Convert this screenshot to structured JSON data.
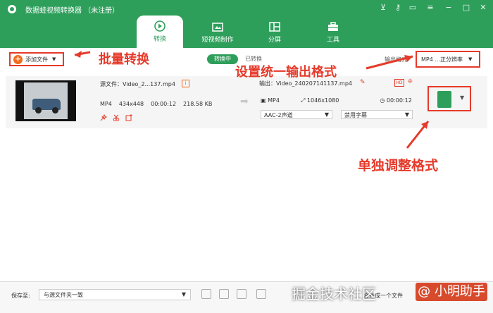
{
  "app": {
    "title": "数据蛙视频转换器 （未注册）"
  },
  "titlebar": {
    "icons": [
      "cart-icon",
      "key-icon",
      "feedback-icon",
      "menu-icon",
      "minimize-icon",
      "maximize-icon",
      "close-icon"
    ]
  },
  "tabs": [
    {
      "label": "转换",
      "icon": "convert-icon",
      "active": true
    },
    {
      "label": "短视频制作",
      "icon": "short-video-icon",
      "active": false
    },
    {
      "label": "分屏",
      "icon": "split-screen-icon",
      "active": false
    },
    {
      "label": "工具",
      "icon": "toolbox-icon",
      "active": false
    }
  ],
  "toolbar": {
    "add_label": "添加文件",
    "seg_converting": "转换中",
    "seg_converted": "已转换",
    "output_format_label": "输出格式:",
    "output_format_value": "MP4 ...正分辨率"
  },
  "file": {
    "source_label": "源文件：Video_2...137.mp4",
    "format": "MP4",
    "resolution": "434x448",
    "duration": "00:00:12",
    "size": "218.58 KB",
    "output_label": "输出：Video_240207141137.mp4",
    "out_format": "MP4",
    "out_resolution": "1046x1080",
    "out_duration": "00:00:12",
    "audio": "AAC-2声道",
    "subtitle": "禁用字幕"
  },
  "bottom": {
    "save_label": "保存至:",
    "save_path": "与源文件夹一致",
    "merge_label": "合并成一个文件"
  },
  "annotations": {
    "batch": "批量转换",
    "unified": "设置统一输出格式",
    "single": "单独调整格式"
  },
  "watermark": {
    "text": "掘金技术社区",
    "badge": "@ 小明助手"
  },
  "colors": {
    "brand": "#2e9f5b",
    "annotation": "#e53a2a"
  }
}
